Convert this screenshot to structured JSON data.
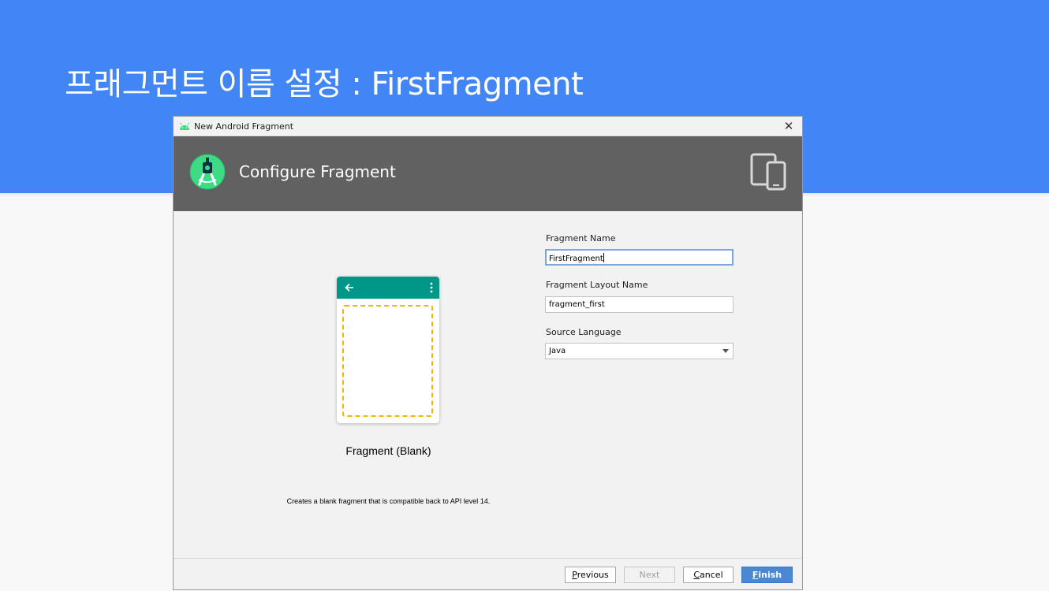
{
  "slide": {
    "title": "프래그먼트 이름 설정 : FirstFragment"
  },
  "dialog": {
    "window_title": "New Android Fragment",
    "header_title": "Configure Fragment",
    "template": {
      "name": "Fragment (Blank)",
      "description": "Creates a blank fragment that is compatible back to API level 14."
    },
    "form": {
      "fragment_name_label": "Fragment Name",
      "fragment_name_value": "FirstFragment",
      "layout_name_label": "Fragment Layout Name",
      "layout_name_value": "fragment_first",
      "source_language_label": "Source Language",
      "source_language_value": "Java"
    },
    "buttons": {
      "previous": {
        "first": "P",
        "rest": "revious"
      },
      "next": "Next",
      "cancel": {
        "first": "C",
        "rest": "ancel"
      },
      "finish": {
        "first": "F",
        "rest": "inish"
      }
    }
  },
  "colors": {
    "slide_header": "#4285f4",
    "banner": "#616161",
    "phone_toolbar": "#009688",
    "placeholder_border": "#f5b400",
    "finish_button": "#4a88d4"
  },
  "icons": [
    "android-icon",
    "close-icon",
    "android-studio-logo-icon",
    "devices-icon",
    "back-arrow-icon",
    "overflow-menu-icon",
    "dropdown-arrow-icon"
  ]
}
